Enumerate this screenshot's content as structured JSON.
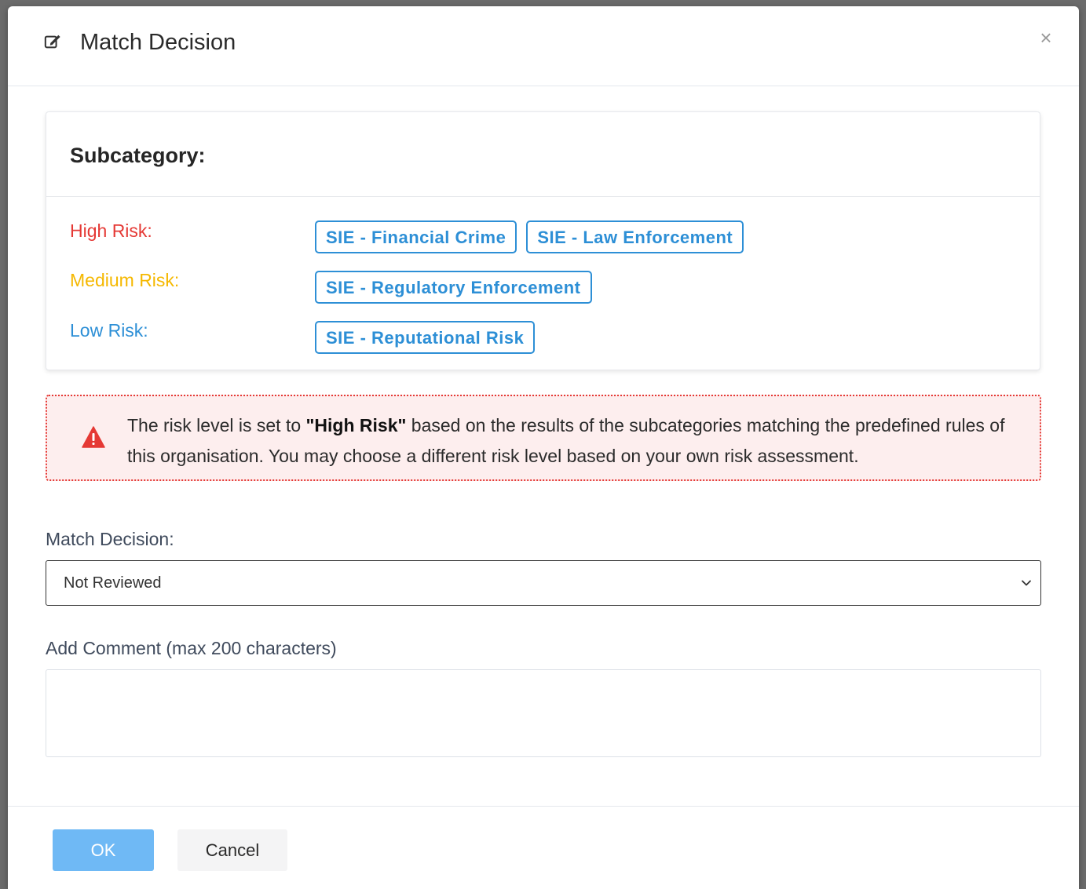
{
  "modal": {
    "title": "Match Decision",
    "title_icon": "edit-icon",
    "close_label": "×"
  },
  "subcategory": {
    "title": "Subcategory:",
    "levels": [
      {
        "label": "High Risk:",
        "color": "#e53935",
        "tags": [
          "SIE - Financial Crime",
          "SIE - Law Enforcement"
        ]
      },
      {
        "label": "Medium Risk:",
        "color": "#f5b800",
        "tags": [
          "SIE - Regulatory Enforcement"
        ]
      },
      {
        "label": "Low Risk:",
        "color": "#2d8fd6",
        "tags": [
          "SIE - Reputational Risk"
        ]
      }
    ],
    "tag_color": "#2d8fd6"
  },
  "alert": {
    "icon": "warning-icon",
    "text_before": "The risk level is set to ",
    "highlight": "\"High Risk\"",
    "text_after": " based on the results of the subcategories matching the predefined rules of this organisation. You may choose a different risk level based on your own risk assessment.",
    "color": "#e53935"
  },
  "form": {
    "decision_label": "Match Decision:",
    "decision_value": "Not Reviewed",
    "comment_label": "Add Comment (max 200 characters)",
    "comment_value": ""
  },
  "footer": {
    "ok_label": "OK",
    "cancel_label": "Cancel",
    "primary_color": "#6fb9f5"
  }
}
